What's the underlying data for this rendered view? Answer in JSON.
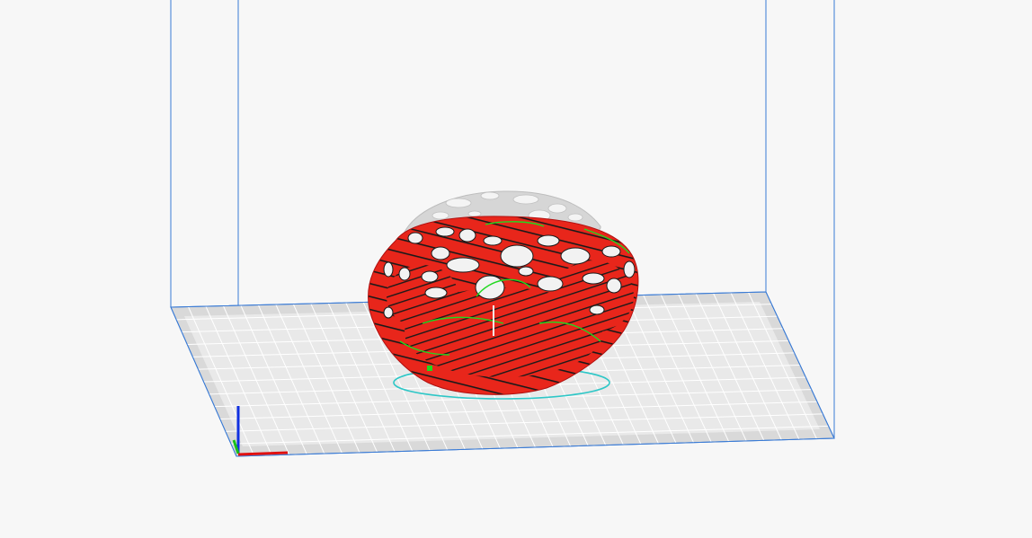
{
  "viewport": {
    "background": "#f7f7f7",
    "build_volume_line_color": "#3a7bd5",
    "plate_color": "#d9d9d9",
    "plate_edge_color": "#cfcfcf",
    "grid_color": "#ffffff"
  },
  "model": {
    "body_color": "#e8261b",
    "contour_color": "#1a1a1a",
    "support_color": "#21d81f",
    "unsliced_color": "#d6d6d6",
    "skirt_color": "#2ec7c7"
  },
  "axes": {
    "x_color": "#e01010",
    "y_color": "#19c019",
    "z_color": "#1030e0"
  }
}
